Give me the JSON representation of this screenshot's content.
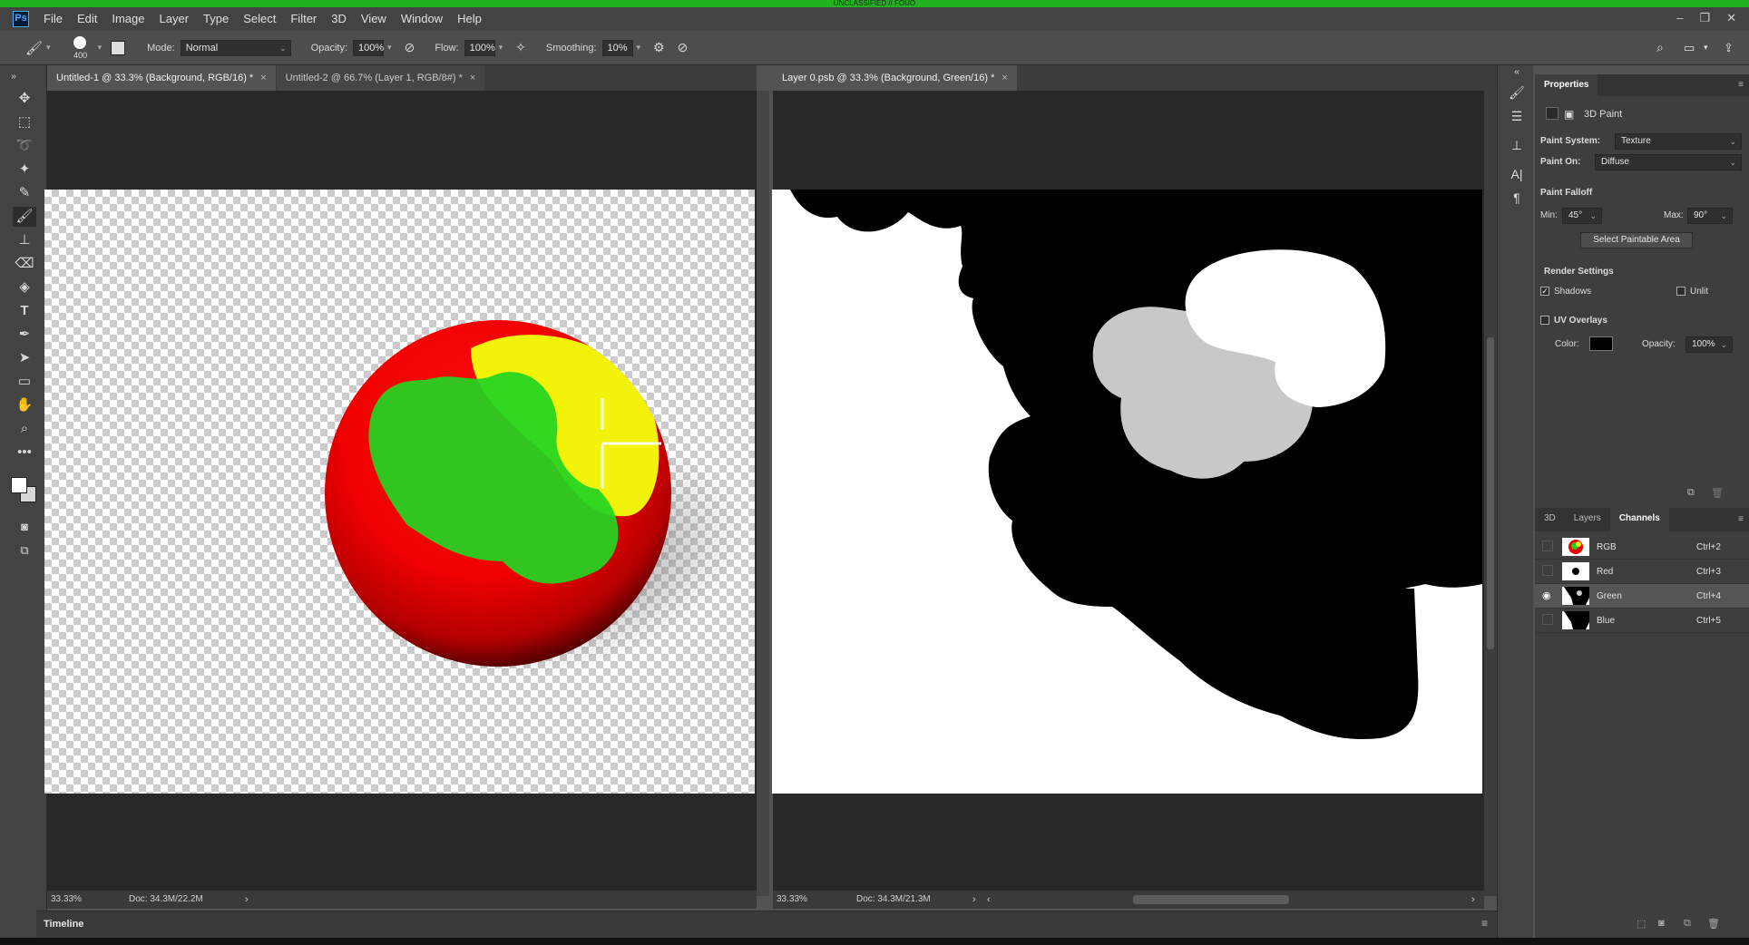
{
  "window": {
    "banner": "UNCLASSIFIED // FOUO"
  },
  "menu": [
    "File",
    "Edit",
    "Image",
    "Layer",
    "Type",
    "Select",
    "Filter",
    "3D",
    "View",
    "Window",
    "Help"
  ],
  "options": {
    "brush_size": "400",
    "mode_label": "Mode:",
    "mode_value": "Normal",
    "opacity_label": "Opacity:",
    "opacity_value": "100%",
    "flow_label": "Flow:",
    "flow_value": "100%",
    "smoothing_label": "Smoothing:",
    "smoothing_value": "10%"
  },
  "tabs_left": [
    {
      "label": "Untitled-1 @ 33.3% (Background, RGB/16) *"
    },
    {
      "label": "Untitled-2 @ 66.7% (Layer 1, RGB/8#) *"
    }
  ],
  "tabs_right": [
    {
      "label": "Layer 0.psb @ 33.3% (Background, Green/16) *"
    }
  ],
  "status_left": {
    "zoom": "33.33%",
    "doc": "Doc: 34.3M/22.2M"
  },
  "status_right": {
    "zoom": "33.33%",
    "doc": "Doc: 34.3M/21.3M"
  },
  "timeline": {
    "label": "Timeline"
  },
  "properties": {
    "tab": "Properties",
    "section": "3D Paint",
    "paint_system_label": "Paint System:",
    "paint_system_value": "Texture",
    "paint_on_label": "Paint On:",
    "paint_on_value": "Diffuse",
    "falloff_title": "Paint Falloff",
    "min_label": "Min:",
    "min_value": "45°",
    "max_label": "Max:",
    "max_value": "90°",
    "select_area_button": "Select Paintable Area",
    "render_title": "Render Settings",
    "shadows_label": "Shadows",
    "unlit_label": "Unlit",
    "uv_label": "UV Overlays",
    "color_label": "Color:",
    "uv_opacity_label": "Opacity:",
    "uv_opacity_value": "100%",
    "overlay_color": "#000000"
  },
  "channels_panel": {
    "tabs": [
      "3D",
      "Layers",
      "Channels"
    ],
    "rows": [
      {
        "name": "RGB",
        "shortcut": "Ctrl+2"
      },
      {
        "name": "Red",
        "shortcut": "Ctrl+3"
      },
      {
        "name": "Green",
        "shortcut": "Ctrl+4"
      },
      {
        "name": "Blue",
        "shortcut": "Ctrl+5"
      }
    ]
  }
}
